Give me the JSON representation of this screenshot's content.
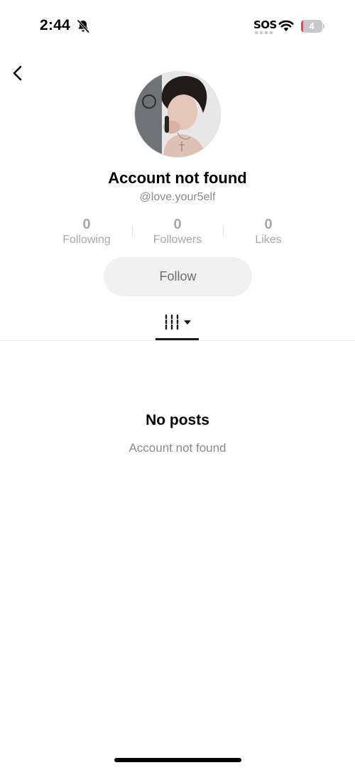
{
  "status_bar": {
    "time": "2:44",
    "sos": "SOS",
    "battery": "4",
    "battery_level": 0.04,
    "icons": [
      "bell-slash-icon",
      "wifi-icon",
      "battery-icon"
    ]
  },
  "header": {
    "back_icon": "chevron-left-icon"
  },
  "profile": {
    "name": "Account not found",
    "handle": "@love.your5elf",
    "avatar": "profile-photo"
  },
  "stats": [
    {
      "value": "0",
      "label": "Following"
    },
    {
      "value": "0",
      "label": "Followers"
    },
    {
      "value": "0",
      "label": "Likes"
    }
  ],
  "follow_button": {
    "label": "Follow"
  },
  "tabs": {
    "active_icon": "grid-filter-icon",
    "dropdown_icon": "caret-down-icon"
  },
  "empty_state": {
    "title": "No posts",
    "subtitle": "Account not found"
  },
  "colors": {
    "accent_dark": "#161823",
    "muted_text": "#8a8a8a",
    "button_bg": "#f1f1f2",
    "battery_low": "#e24b4b"
  }
}
